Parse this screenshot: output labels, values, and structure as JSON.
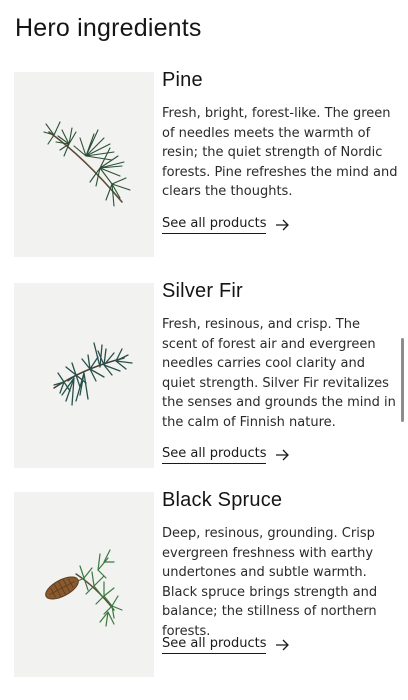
{
  "page": {
    "title": "Hero ingredients"
  },
  "ingredients": [
    {
      "name": "Pine",
      "description": "Fresh, bright, forest-like. The green of needles meets the warmth of resin; the quiet strength of Nordic forests. Pine refreshes the mind and clears the thoughts.",
      "link_label": "See all products",
      "image_icon": "pine-branch-icon"
    },
    {
      "name": "Silver Fir",
      "description": "Fresh, resinous, and crisp. The scent of forest air and evergreen needles carries cool clarity and quiet strength. Silver Fir revitalizes the senses and grounds the mind in the calm of Finnish nature.",
      "link_label": "See all products",
      "image_icon": "fir-branch-icon"
    },
    {
      "name": "Black Spruce",
      "description": "Deep, resinous, grounding. Crisp evergreen freshness with earthy undertones and subtle warmth. Black spruce brings strength and balance; the stillness of northern forests.",
      "link_label": "See all products",
      "image_icon": "spruce-branch-with-cone-icon"
    }
  ],
  "colors": {
    "background": "#ffffff",
    "thumb_bg": "#f2f2f1",
    "text": "#1f1f1f",
    "needle_green": "#2f5a3e"
  }
}
